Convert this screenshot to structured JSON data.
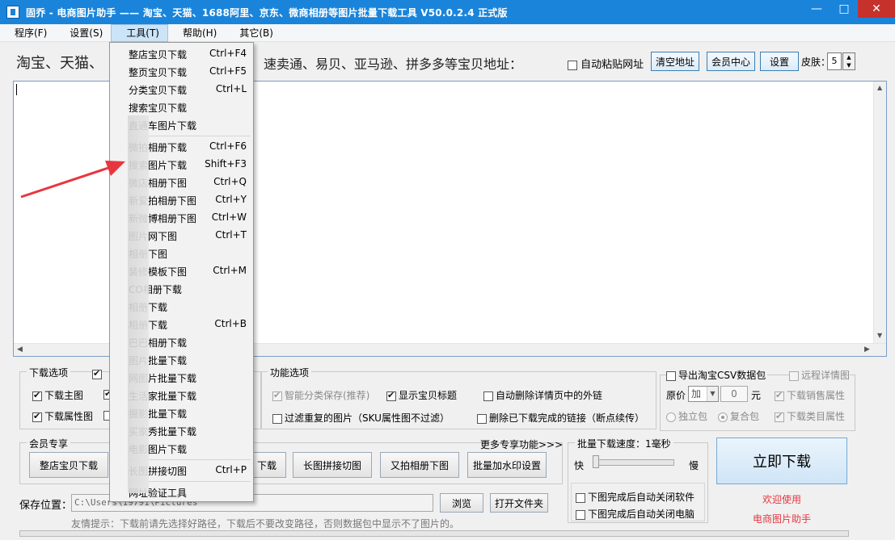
{
  "window": {
    "title": "固乔 - 电商图片助手 —— 淘宝、天猫、1688阿里、京东、微商相册等图片批量下载工具 V50.0.2.4 正式版",
    "min_glyph": "—",
    "max_glyph": "□",
    "close_glyph": "✕"
  },
  "menubar": {
    "items": [
      "程序(F)",
      "设置(S)",
      "工具(T)",
      "帮助(H)",
      "其它(B)"
    ],
    "active": "工具(T)"
  },
  "address": {
    "label_left": "淘宝、天猫、",
    "label_right": "速卖通、易贝、亚马逊、拼多多等宝贝地址：",
    "auto_paste": "自动粘贴网址",
    "clear_button": "清空地址",
    "member_button": "会员中心",
    "settings_button": "设置",
    "skin_label": "皮肤：",
    "skin_value": "5"
  },
  "dropdown": {
    "items": [
      {
        "label": "整店宝贝下载",
        "shortcut": "Ctrl+F4"
      },
      {
        "label": "整页宝贝下载",
        "shortcut": "Ctrl+F5"
      },
      {
        "label": "分类宝贝下载",
        "shortcut": "Ctrl+L"
      },
      {
        "label": "搜索宝贝下载",
        "shortcut": ""
      },
      {
        "label": "直通车图片下载",
        "shortcut": ""
      },
      {
        "label": "微拍相册下载",
        "shortcut": "Ctrl+F6"
      },
      {
        "label": "搜索图片下载",
        "shortcut": "Shift+F3"
      },
      {
        "label": "微店相册下图",
        "shortcut": "Ctrl+Q"
      },
      {
        "label": "新爱拍相册下图",
        "shortcut": "Ctrl+Y"
      },
      {
        "label": "新微博相册下图",
        "shortcut": "Ctrl+W"
      },
      {
        "label": "图片网下图",
        "shortcut": "Ctrl+T"
      },
      {
        "label": "相册下图",
        "shortcut": ""
      },
      {
        "label": "装修模板下图",
        "shortcut": "Ctrl+M"
      },
      {
        "label": "CO相册下载",
        "shortcut": ""
      },
      {
        "label": "相册下载",
        "shortcut": ""
      },
      {
        "label": "相册下载",
        "shortcut": "Ctrl+B"
      },
      {
        "label": "巴巴相册下载",
        "shortcut": ""
      },
      {
        "label": "图片批量下载",
        "shortcut": ""
      },
      {
        "label": "网图片批量下载",
        "shortcut": ""
      },
      {
        "label": "生活家批量下载",
        "shortcut": ""
      },
      {
        "label": "摄影批量下载",
        "shortcut": ""
      },
      {
        "label": "买家秀批量下载",
        "shortcut": ""
      },
      {
        "label": "电影图片下载",
        "shortcut": ""
      },
      {
        "label": "长图拼接切图",
        "shortcut": "Ctrl+P"
      },
      {
        "label": "网址验证工具",
        "shortcut": ""
      }
    ]
  },
  "download_options": {
    "title": "下载选项",
    "main_image": "下载主图",
    "attr_image": "下载属性图"
  },
  "function_options": {
    "title": "功能选项",
    "smart_save": "智能分类保存(推荐)",
    "show_title": "显示宝贝标题",
    "auto_delete_links": "自动删除详情页中的外链",
    "filter_duplicate": "过滤重复的图片（SKU属性图不过滤）",
    "delete_done_links": "删除已下载完成的链接（断点续传）"
  },
  "csv_options": {
    "export_csv": "导出淘宝CSV数据包",
    "remote_detail": "远程详情图",
    "price_label": "原价",
    "price_op": "加",
    "price_value": "0",
    "price_unit": "元",
    "sales_attr": "下载销售属性",
    "standalone": "独立包",
    "composite": "复合包",
    "category_attr": "下载类目属性"
  },
  "member": {
    "title": "会员专享",
    "more": "更多专享功能>>>",
    "buttons": [
      "整店宝贝下载",
      "下载",
      "长图拼接切图",
      "又拍相册下图",
      "批量加水印设置"
    ]
  },
  "speed": {
    "label": "批量下载速度：1毫秒",
    "fast": "快",
    "slow": "慢",
    "close_app": "下图完成后自动关闭软件",
    "close_pc": "下图完成后自动关闭电脑"
  },
  "start": {
    "button": "立即下载",
    "welcome1": "欢迎使用",
    "welcome2": "电商图片助手"
  },
  "save": {
    "label": "保存位置：",
    "path": "C:\\Users\\19791\\Pictures",
    "browse": "浏览",
    "open_folder": "打开文件夹",
    "hint": "友情提示：下载前请先选择好路径，下载后不要改变路径，否则数据包中显示不了图片的。"
  },
  "colors": {
    "titlebar": "#1a84da",
    "arrow": "#e8363f",
    "welcome": "#e8363f"
  }
}
